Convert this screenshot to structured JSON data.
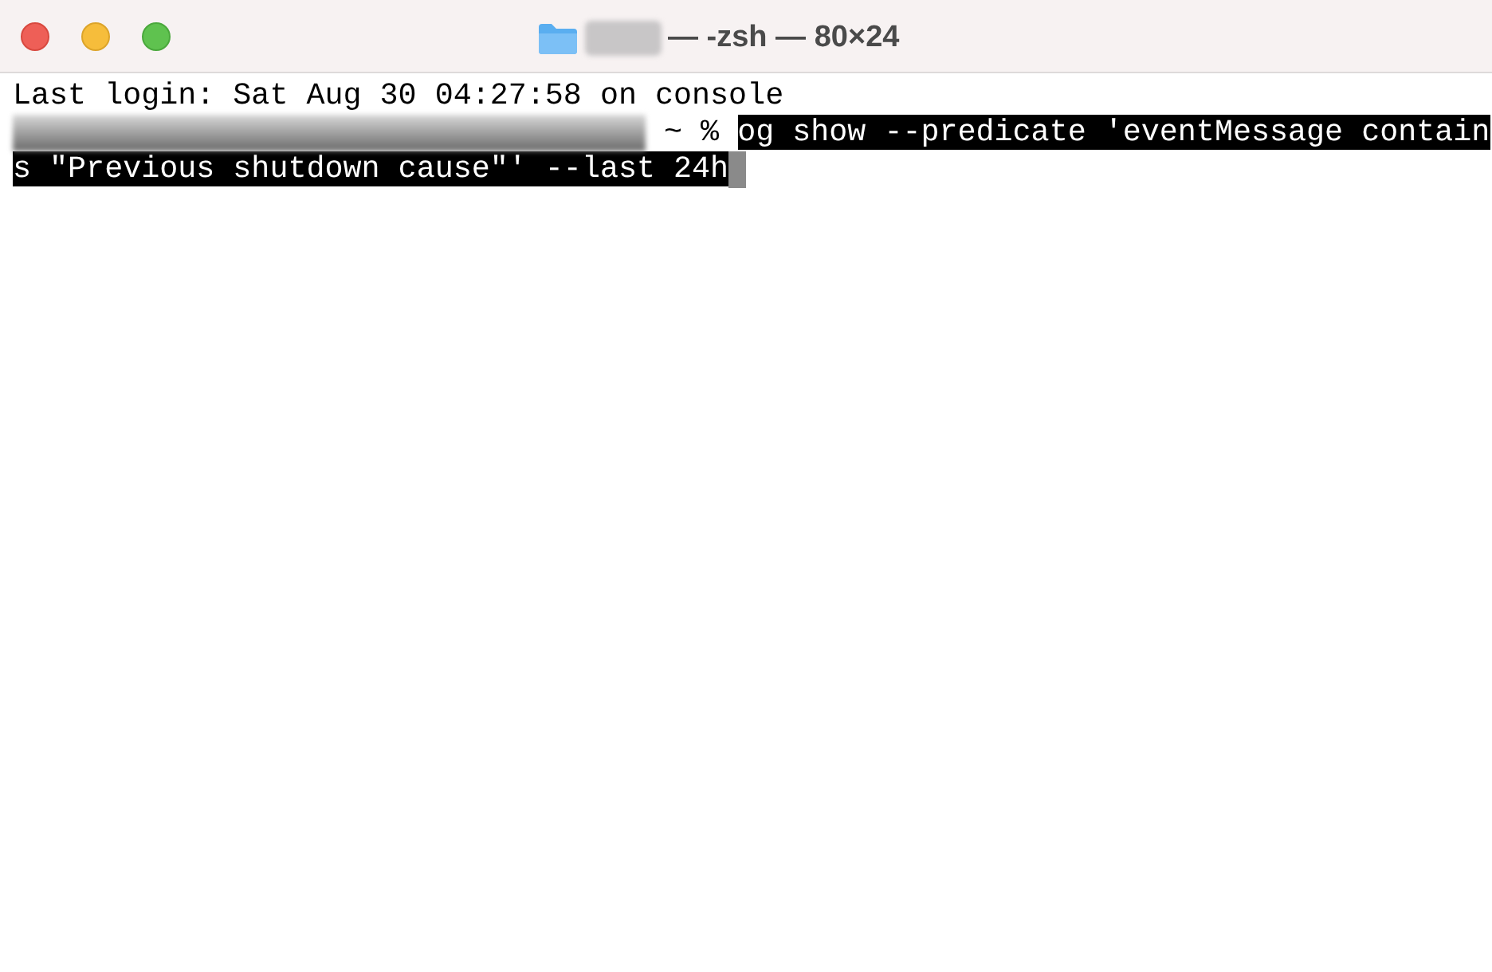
{
  "window": {
    "title_segments": [
      {
        "kind": "redacted"
      },
      {
        "kind": "text",
        "text": "— -zsh — 80×24"
      }
    ]
  },
  "terminal": {
    "lines": [
      {
        "segments": [
          {
            "kind": "text",
            "text": "Last login: Sat Aug 30 04:27:58 on console"
          }
        ]
      },
      {
        "segments": [
          {
            "kind": "redacted"
          },
          {
            "kind": "text",
            "text": " ~ % "
          },
          {
            "kind": "selected",
            "text": "og show --predicate 'eventMessage contain"
          }
        ]
      },
      {
        "segments": [
          {
            "kind": "selected",
            "text": "s \"Previous shutdown cause\"' --last 24h"
          },
          {
            "kind": "cursor"
          }
        ]
      }
    ]
  }
}
